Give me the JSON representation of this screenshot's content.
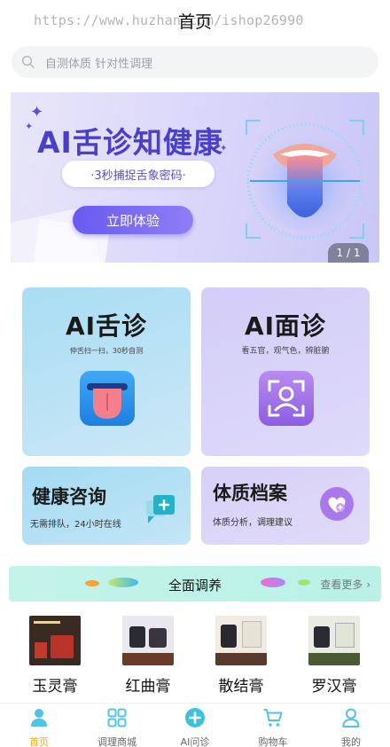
{
  "header": {
    "title": "首页",
    "watermark": "https://www.huzhan.com/ishop26990"
  },
  "search": {
    "placeholder": "自测体质 针对性调理"
  },
  "banner": {
    "headline": "AI舌诊知健康",
    "tagline": "·3秒捕捉舌象密码·",
    "cta": "立即体验",
    "counter": "1 / 1"
  },
  "cards": {
    "tongue": {
      "title": "AI舌诊",
      "subtitle": "伸舌扫一扫，30秒自测",
      "icon": "tongue-icon"
    },
    "face": {
      "title": "AI面诊",
      "subtitle": "看五官，观气色，辨脏腑",
      "icon": "face-scan-icon"
    },
    "consult": {
      "title": "健康咨询",
      "subtitle": "无需排队，24小时在线",
      "icon": "chat-plus-icon"
    },
    "archive": {
      "title": "体质档案",
      "subtitle": "体质分析，调理建议",
      "icon": "heart-plus-icon"
    }
  },
  "section": {
    "title": "全面调养",
    "more": "查看更多"
  },
  "products": [
    {
      "name": "玉灵膏"
    },
    {
      "name": "红曲膏"
    },
    {
      "name": "散结膏"
    },
    {
      "name": "罗汉膏"
    }
  ],
  "tabbar": {
    "items": [
      {
        "label": "首页",
        "icon": "user-icon",
        "active": true
      },
      {
        "label": "调理商城",
        "icon": "grid-icon",
        "active": false
      },
      {
        "label": "AI问诊",
        "icon": "plus-circle-icon",
        "active": false
      },
      {
        "label": "购物车",
        "icon": "cart-icon",
        "active": false
      },
      {
        "label": "我的",
        "icon": "person-icon",
        "active": false
      }
    ]
  },
  "colors": {
    "accent": "#e8a81e",
    "brand_purple": "#5a4fcc",
    "teal": "#2ec4c0",
    "tab_icon": "#4fc3e8"
  }
}
